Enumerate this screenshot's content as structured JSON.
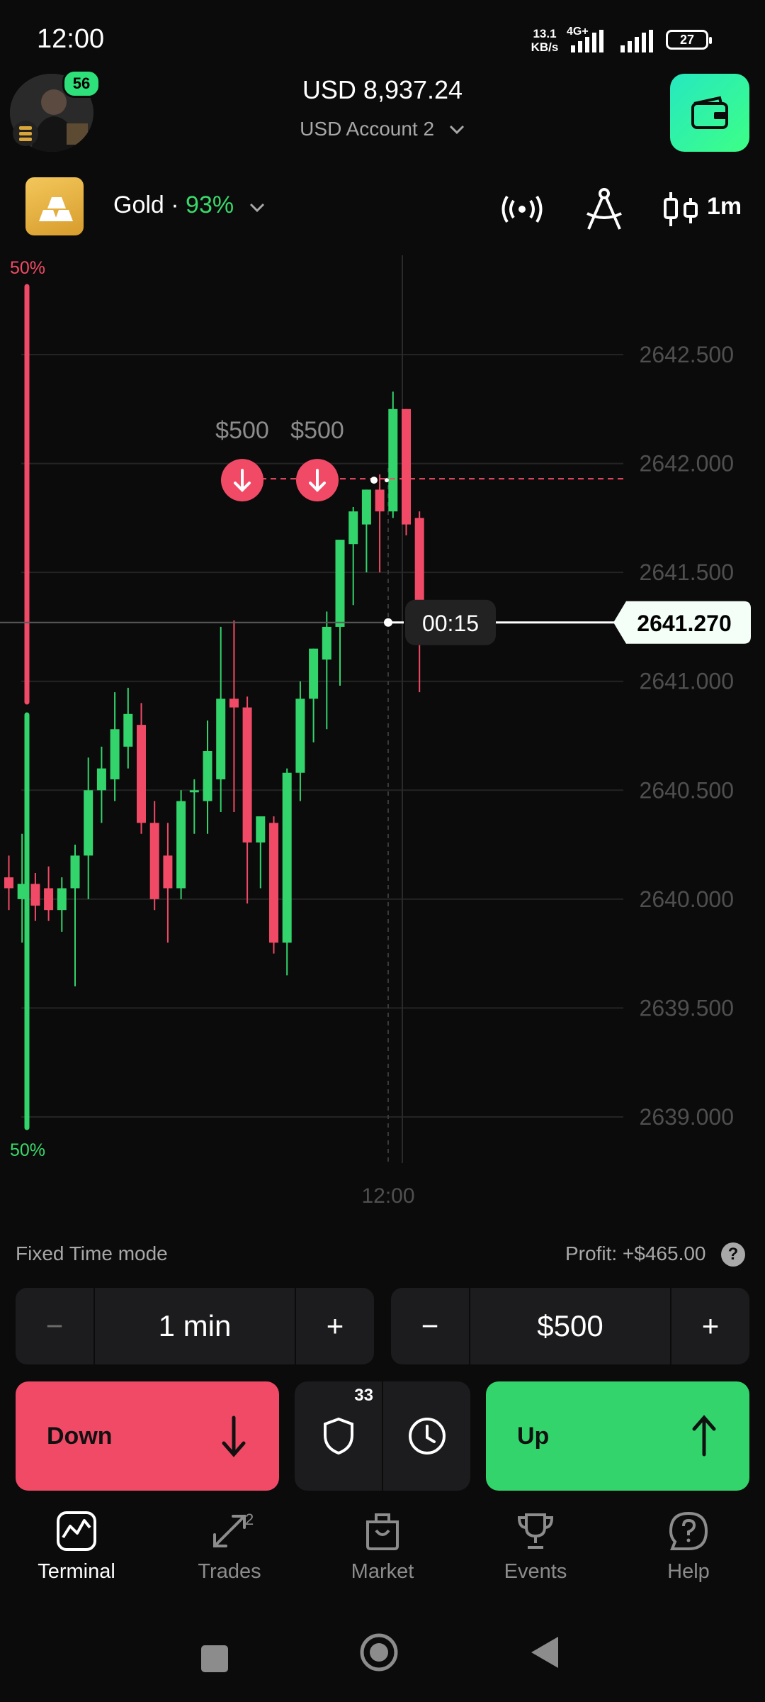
{
  "status_bar": {
    "time": "12:00",
    "net_speed": "13.1",
    "net_unit": "KB/s",
    "net_type": "4G+",
    "battery": "27"
  },
  "header": {
    "level": "56",
    "balance": "USD 8,937.24",
    "account": "USD Account 2"
  },
  "asset": {
    "name": "Gold",
    "separator": " · ",
    "payout": "93%",
    "timeframe": "1m"
  },
  "chart_data": {
    "type": "candlestick",
    "ylim": [
      2638.7,
      2642.95
    ],
    "y_ticks": [
      "2642.500",
      "2642.000",
      "2641.500",
      "2641.000",
      "2640.500",
      "2640.000",
      "2639.500",
      "2639.000"
    ],
    "y_tick_values": [
      2642.5,
      2642.0,
      2641.5,
      2641.0,
      2640.5,
      2640.0,
      2639.5,
      2639.0
    ],
    "x_label": "12:00",
    "sentiment_top": "50%",
    "sentiment_bottom": "50%",
    "current_price": "2641.270",
    "current_price_value": 2641.27,
    "countdown": "00:15",
    "strike_price": 2641.93,
    "trades": [
      {
        "amount": "$500",
        "direction": "down"
      },
      {
        "amount": "$500",
        "direction": "down"
      }
    ],
    "candles": [
      {
        "o": 2640.1,
        "h": 2640.2,
        "l": 2639.95,
        "c": 2640.05
      },
      {
        "o": 2640.0,
        "h": 2640.3,
        "l": 2639.8,
        "c": 2640.07
      },
      {
        "o": 2640.07,
        "h": 2640.12,
        "l": 2639.9,
        "c": 2639.97
      },
      {
        "o": 2640.05,
        "h": 2640.15,
        "l": 2639.9,
        "c": 2639.95
      },
      {
        "o": 2639.95,
        "h": 2640.1,
        "l": 2639.85,
        "c": 2640.05
      },
      {
        "o": 2640.05,
        "h": 2640.25,
        "l": 2639.6,
        "c": 2640.2
      },
      {
        "o": 2640.2,
        "h": 2640.65,
        "l": 2640.0,
        "c": 2640.5
      },
      {
        "o": 2640.5,
        "h": 2640.7,
        "l": 2640.35,
        "c": 2640.6
      },
      {
        "o": 2640.55,
        "h": 2640.95,
        "l": 2640.45,
        "c": 2640.78
      },
      {
        "o": 2640.7,
        "h": 2640.97,
        "l": 2640.6,
        "c": 2640.85
      },
      {
        "o": 2640.8,
        "h": 2640.9,
        "l": 2640.3,
        "c": 2640.35
      },
      {
        "o": 2640.35,
        "h": 2640.45,
        "l": 2639.95,
        "c": 2640.0
      },
      {
        "o": 2640.2,
        "h": 2640.35,
        "l": 2639.8,
        "c": 2640.05
      },
      {
        "o": 2640.05,
        "h": 2640.5,
        "l": 2640.0,
        "c": 2640.45
      },
      {
        "o": 2640.5,
        "h": 2640.55,
        "l": 2640.3,
        "c": 2640.5
      },
      {
        "o": 2640.45,
        "h": 2640.82,
        "l": 2640.3,
        "c": 2640.68
      },
      {
        "o": 2640.55,
        "h": 2641.25,
        "l": 2640.4,
        "c": 2640.92
      },
      {
        "o": 2640.92,
        "h": 2641.28,
        "l": 2640.4,
        "c": 2640.88
      },
      {
        "o": 2640.88,
        "h": 2640.93,
        "l": 2639.98,
        "c": 2640.26
      },
      {
        "o": 2640.26,
        "h": 2640.36,
        "l": 2640.05,
        "c": 2640.38
      },
      {
        "o": 2640.35,
        "h": 2640.38,
        "l": 2639.75,
        "c": 2639.8
      },
      {
        "o": 2639.8,
        "h": 2640.6,
        "l": 2639.65,
        "c": 2640.58
      },
      {
        "o": 2640.58,
        "h": 2641.0,
        "l": 2640.45,
        "c": 2640.92
      },
      {
        "o": 2640.92,
        "h": 2641.15,
        "l": 2640.72,
        "c": 2641.15
      },
      {
        "o": 2641.1,
        "h": 2641.32,
        "l": 2640.78,
        "c": 2641.25
      },
      {
        "o": 2641.25,
        "h": 2641.45,
        "l": 2640.98,
        "c": 2641.65
      },
      {
        "o": 2641.63,
        "h": 2641.8,
        "l": 2641.35,
        "c": 2641.78
      },
      {
        "o": 2641.72,
        "h": 2641.88,
        "l": 2641.5,
        "c": 2641.88
      },
      {
        "o": 2641.88,
        "h": 2641.95,
        "l": 2641.5,
        "c": 2641.78
      },
      {
        "o": 2641.78,
        "h": 2642.33,
        "l": 2641.75,
        "c": 2642.25
      },
      {
        "o": 2642.25,
        "h": 2642.25,
        "l": 2641.67,
        "c": 2641.72
      },
      {
        "o": 2641.75,
        "h": 2641.78,
        "l": 2640.95,
        "c": 2641.27
      }
    ]
  },
  "panel": {
    "mode": "Fixed Time mode",
    "profit_label": "Profit:",
    "profit_value": "+$465.00",
    "help": "?",
    "time_minus": "−",
    "time_value": "1 min",
    "time_plus": "+",
    "amount_minus": "−",
    "amount_value": "$500",
    "amount_plus": "+",
    "down_label": "Down",
    "up_label": "Up",
    "shield_count": "33"
  },
  "nav": {
    "terminal": "Terminal",
    "trades": "Trades",
    "trades_badge": "2",
    "market": "Market",
    "events": "Events",
    "help": "Help"
  },
  "colors": {
    "up": "#33d46b",
    "down": "#f14a66",
    "background": "#0b0b0b",
    "panel": "#1c1c1e",
    "accent": "#26e8c0"
  }
}
